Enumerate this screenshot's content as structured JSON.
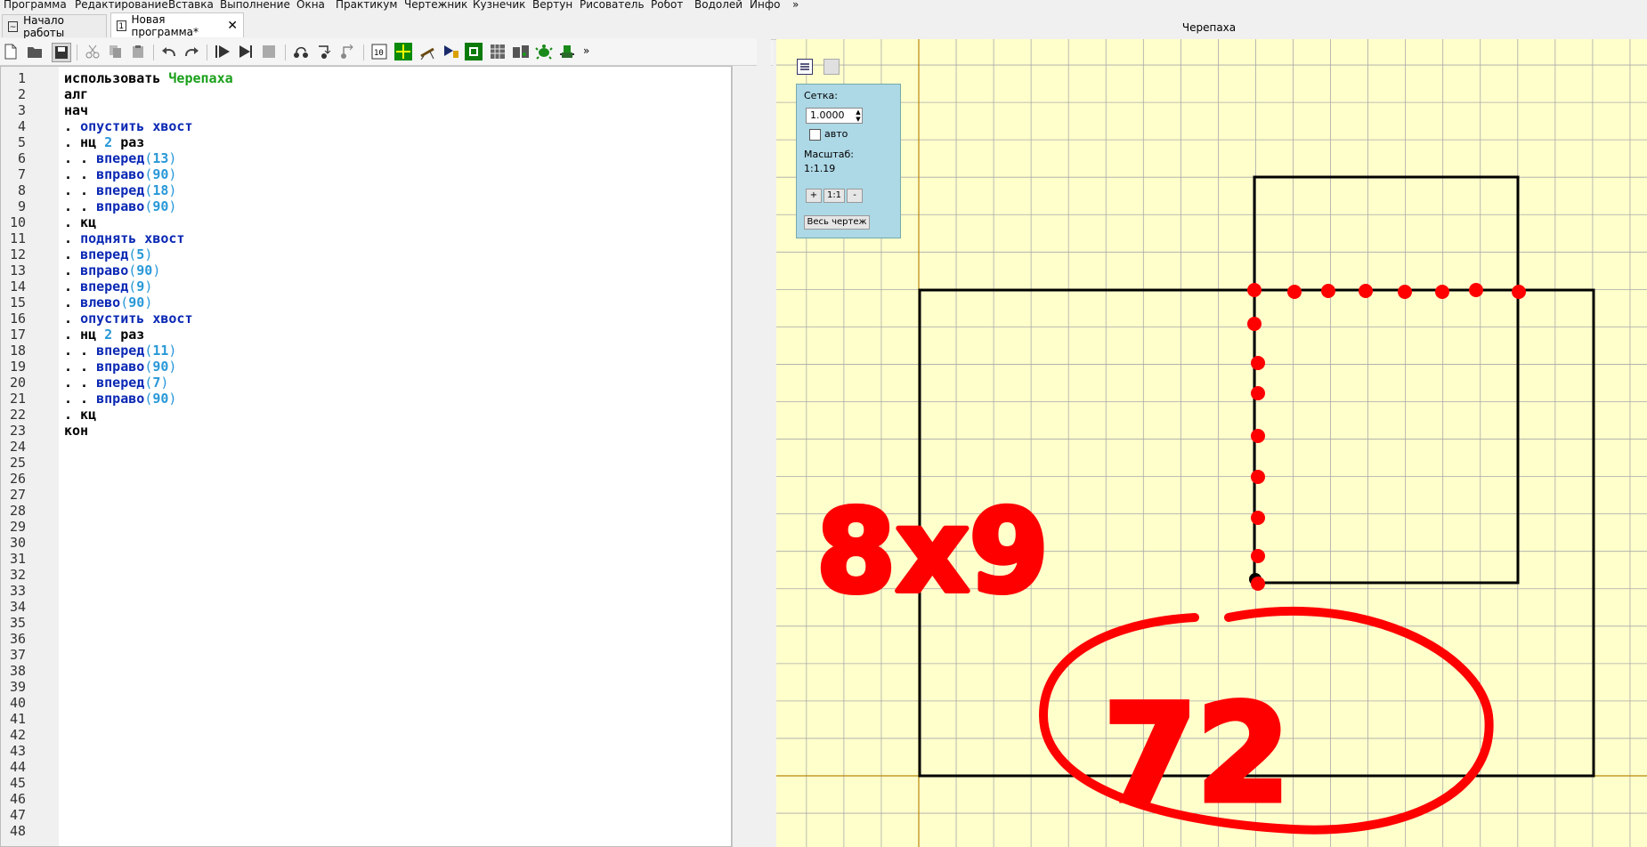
{
  "menu": [
    "Программа",
    "Редактирование",
    "Вставка",
    "Выполнение",
    "Окна",
    "Практикум",
    "Чертежник",
    "Кузнечик",
    "Вертун",
    "Рисователь",
    "Робот",
    "Водолей",
    "Инфо",
    "»"
  ],
  "tabs": [
    {
      "label": "Начало работы"
    },
    {
      "label": "Новая программа*",
      "badge": "1"
    }
  ],
  "toolbar": {
    "overflow": "»"
  },
  "editor": {
    "line_numbers": [
      "1",
      "2",
      "3",
      "4",
      "5",
      "6",
      "7",
      "8",
      "9",
      "10",
      "11",
      "12",
      "13",
      "14",
      "15",
      "16",
      "17",
      "18",
      "19",
      "20",
      "21",
      "22",
      "23",
      "24",
      "25",
      "26",
      "27",
      "28",
      "29",
      "30",
      "31",
      "32",
      "33",
      "34",
      "35",
      "36",
      "37",
      "38",
      "39",
      "40",
      "41",
      "42",
      "43",
      "44",
      "45",
      "46",
      "47",
      "48"
    ],
    "lines": [
      [
        [
          "kw",
          "использовать "
        ],
        [
          "mod",
          "Черепаха"
        ]
      ],
      [
        [
          "kw",
          "алг"
        ]
      ],
      [
        [
          "kw",
          "нач"
        ]
      ],
      [
        [
          "kw",
          ". "
        ],
        [
          "fn",
          "опустить хвост"
        ]
      ],
      [
        [
          "kw",
          ". нц "
        ],
        [
          "num",
          "2"
        ],
        [
          "kw",
          " раз"
        ]
      ],
      [
        [
          "kw",
          ". . "
        ],
        [
          "fn",
          "вперед"
        ],
        [
          "par",
          "("
        ],
        [
          "num",
          "13"
        ],
        [
          "par",
          ")"
        ]
      ],
      [
        [
          "kw",
          ". . "
        ],
        [
          "fn",
          "вправо"
        ],
        [
          "par",
          "("
        ],
        [
          "num",
          "90"
        ],
        [
          "par",
          ")"
        ]
      ],
      [
        [
          "kw",
          ". . "
        ],
        [
          "fn",
          "вперед"
        ],
        [
          "par",
          "("
        ],
        [
          "num",
          "18"
        ],
        [
          "par",
          ")"
        ]
      ],
      [
        [
          "kw",
          ". . "
        ],
        [
          "fn",
          "вправо"
        ],
        [
          "par",
          "("
        ],
        [
          "num",
          "90"
        ],
        [
          "par",
          ")"
        ]
      ],
      [
        [
          "kw",
          ". кц"
        ]
      ],
      [
        [
          "kw",
          ". "
        ],
        [
          "fn",
          "поднять хвост"
        ]
      ],
      [
        [
          "kw",
          ". "
        ],
        [
          "fn",
          "вперед"
        ],
        [
          "par",
          "("
        ],
        [
          "num",
          "5"
        ],
        [
          "par",
          ")"
        ]
      ],
      [
        [
          "kw",
          ". "
        ],
        [
          "fn",
          "вправо"
        ],
        [
          "par",
          "("
        ],
        [
          "num",
          "90"
        ],
        [
          "par",
          ")"
        ]
      ],
      [
        [
          "kw",
          ". "
        ],
        [
          "fn",
          "вперед"
        ],
        [
          "par",
          "("
        ],
        [
          "num",
          "9"
        ],
        [
          "par",
          ")"
        ]
      ],
      [
        [
          "kw",
          ". "
        ],
        [
          "fn",
          "влево"
        ],
        [
          "par",
          "("
        ],
        [
          "num",
          "90"
        ],
        [
          "par",
          ")"
        ]
      ],
      [
        [
          "kw",
          ". "
        ],
        [
          "fn",
          "опустить хвост"
        ]
      ],
      [
        [
          "kw",
          ". нц "
        ],
        [
          "num",
          "2"
        ],
        [
          "kw",
          " раз"
        ]
      ],
      [
        [
          "kw",
          ". . "
        ],
        [
          "fn",
          "вперед"
        ],
        [
          "par",
          "("
        ],
        [
          "num",
          "11"
        ],
        [
          "par",
          ")"
        ]
      ],
      [
        [
          "kw",
          ". . "
        ],
        [
          "fn",
          "вправо"
        ],
        [
          "par",
          "("
        ],
        [
          "num",
          "90"
        ],
        [
          "par",
          ")"
        ]
      ],
      [
        [
          "kw",
          ". . "
        ],
        [
          "fn",
          "вперед"
        ],
        [
          "par",
          "("
        ],
        [
          "num",
          "7"
        ],
        [
          "par",
          ")"
        ]
      ],
      [
        [
          "kw",
          ". . "
        ],
        [
          "fn",
          "вправо"
        ],
        [
          "par",
          "("
        ],
        [
          "num",
          "90"
        ],
        [
          "par",
          ")"
        ]
      ],
      [
        [
          "kw",
          ". кц"
        ]
      ],
      [
        [
          "kw",
          "кон"
        ]
      ]
    ]
  },
  "turtle": {
    "title": "Черепаха",
    "grid_label": "Сетка:",
    "grid_value": "1.0000",
    "auto_label": "авто",
    "scale_label": "Масштаб:",
    "scale_value": "1:1.19",
    "zoom_in": "+",
    "zoom_reset": "1:1",
    "zoom_out": "-",
    "fit_button": "Весь чертеж",
    "annotation_dims": "8x9",
    "annotation_result": "72"
  },
  "colors": {
    "canvas_bg": "#ffffcc",
    "grid": "#a9a9a9",
    "axis": "#b8860b",
    "ink": "#000000",
    "annotation": "#ff0000",
    "panel": "#add8e6"
  }
}
